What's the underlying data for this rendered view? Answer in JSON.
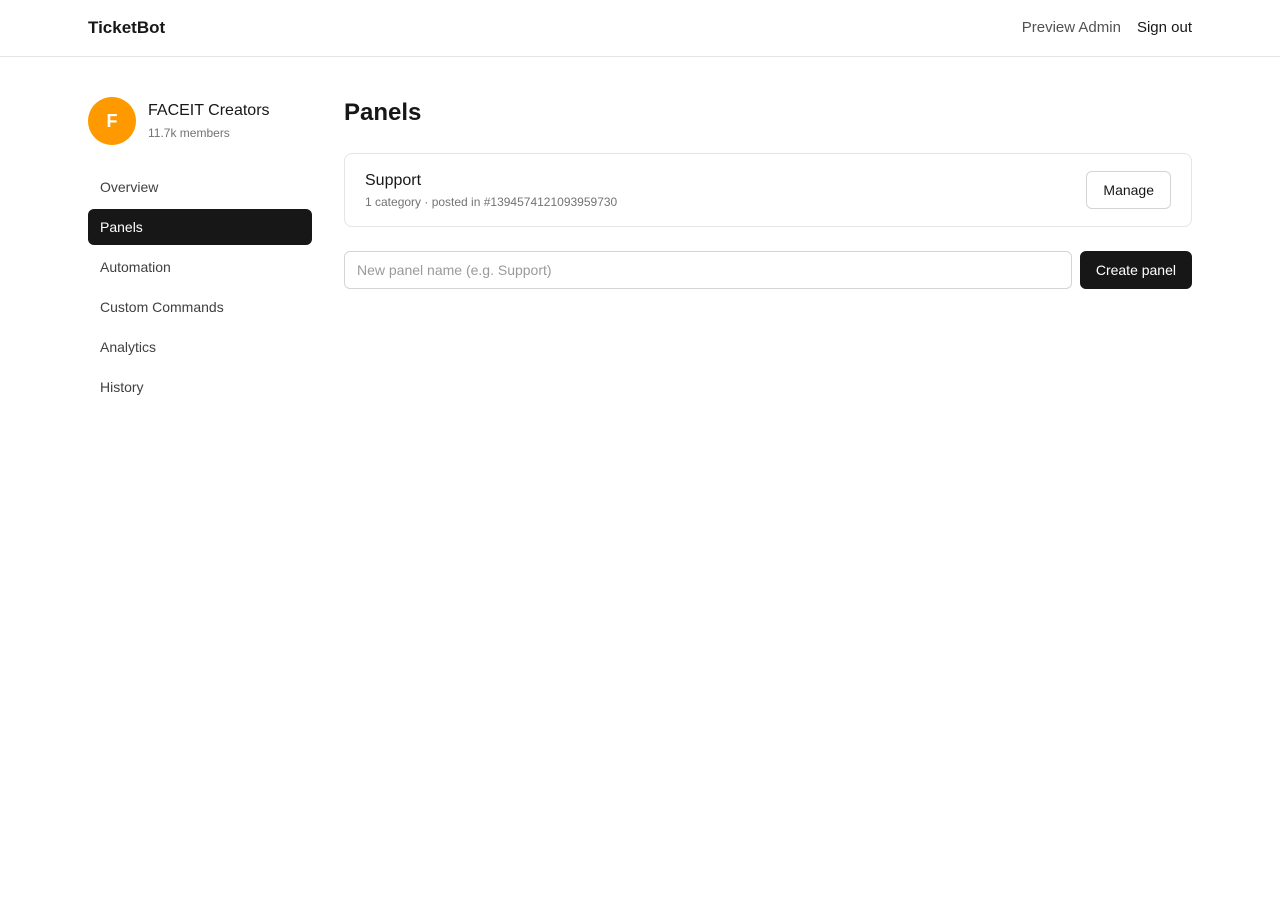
{
  "header": {
    "brand": "TicketBot",
    "links": {
      "preview_admin": "Preview Admin",
      "sign_out": "Sign out"
    }
  },
  "server": {
    "avatar_letter": "F",
    "avatar_color": "#ff9900",
    "name": "FACEIT Creators",
    "members": "11.7k members"
  },
  "sidebar": {
    "active": "Panels",
    "items": [
      {
        "label": "Overview"
      },
      {
        "label": "Panels"
      },
      {
        "label": "Automation"
      },
      {
        "label": "Custom Commands"
      },
      {
        "label": "Analytics"
      },
      {
        "label": "History"
      }
    ]
  },
  "main": {
    "title": "Panels",
    "panels": [
      {
        "name": "Support",
        "meta": "1 category · posted in #1394574121093959730",
        "manage_label": "Manage"
      }
    ],
    "create": {
      "placeholder": "New panel name (e.g. Support)",
      "value": "",
      "button_label": "Create panel"
    }
  },
  "colors": {
    "accent": "#171717",
    "avatar": "#ff9900",
    "border": "#e5e5e5"
  }
}
